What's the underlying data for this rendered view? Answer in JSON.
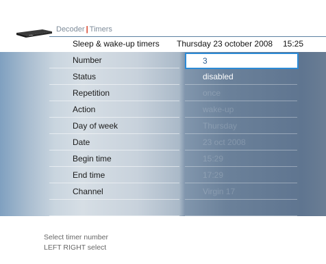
{
  "header": {
    "breadcrumb_decoder": "Decoder",
    "breadcrumb_timers": "Timers",
    "title": "Sleep & wake-up timers",
    "date": "Thursday 23 october 2008",
    "time": "15:25"
  },
  "fields": [
    {
      "label": "Number",
      "value": "3"
    },
    {
      "label": "Status",
      "value": "disabled"
    },
    {
      "label": "Repetition",
      "value": "once"
    },
    {
      "label": "Action",
      "value": "wake-up"
    },
    {
      "label": "Day of week",
      "value": "Thursday"
    },
    {
      "label": "Date",
      "value": "23 oct 2008"
    },
    {
      "label": "Begin time",
      "value": "15:29"
    },
    {
      "label": "End time",
      "value": "17:29"
    },
    {
      "label": "Channel",
      "value": "Virgin 17"
    }
  ],
  "help": {
    "line1": "Select timer number",
    "line2": "LEFT RIGHT select"
  },
  "colors": {
    "accent": "#2b8ad6",
    "separator": "#d3341a"
  },
  "icons": {
    "device": "set-top-box-icon"
  }
}
